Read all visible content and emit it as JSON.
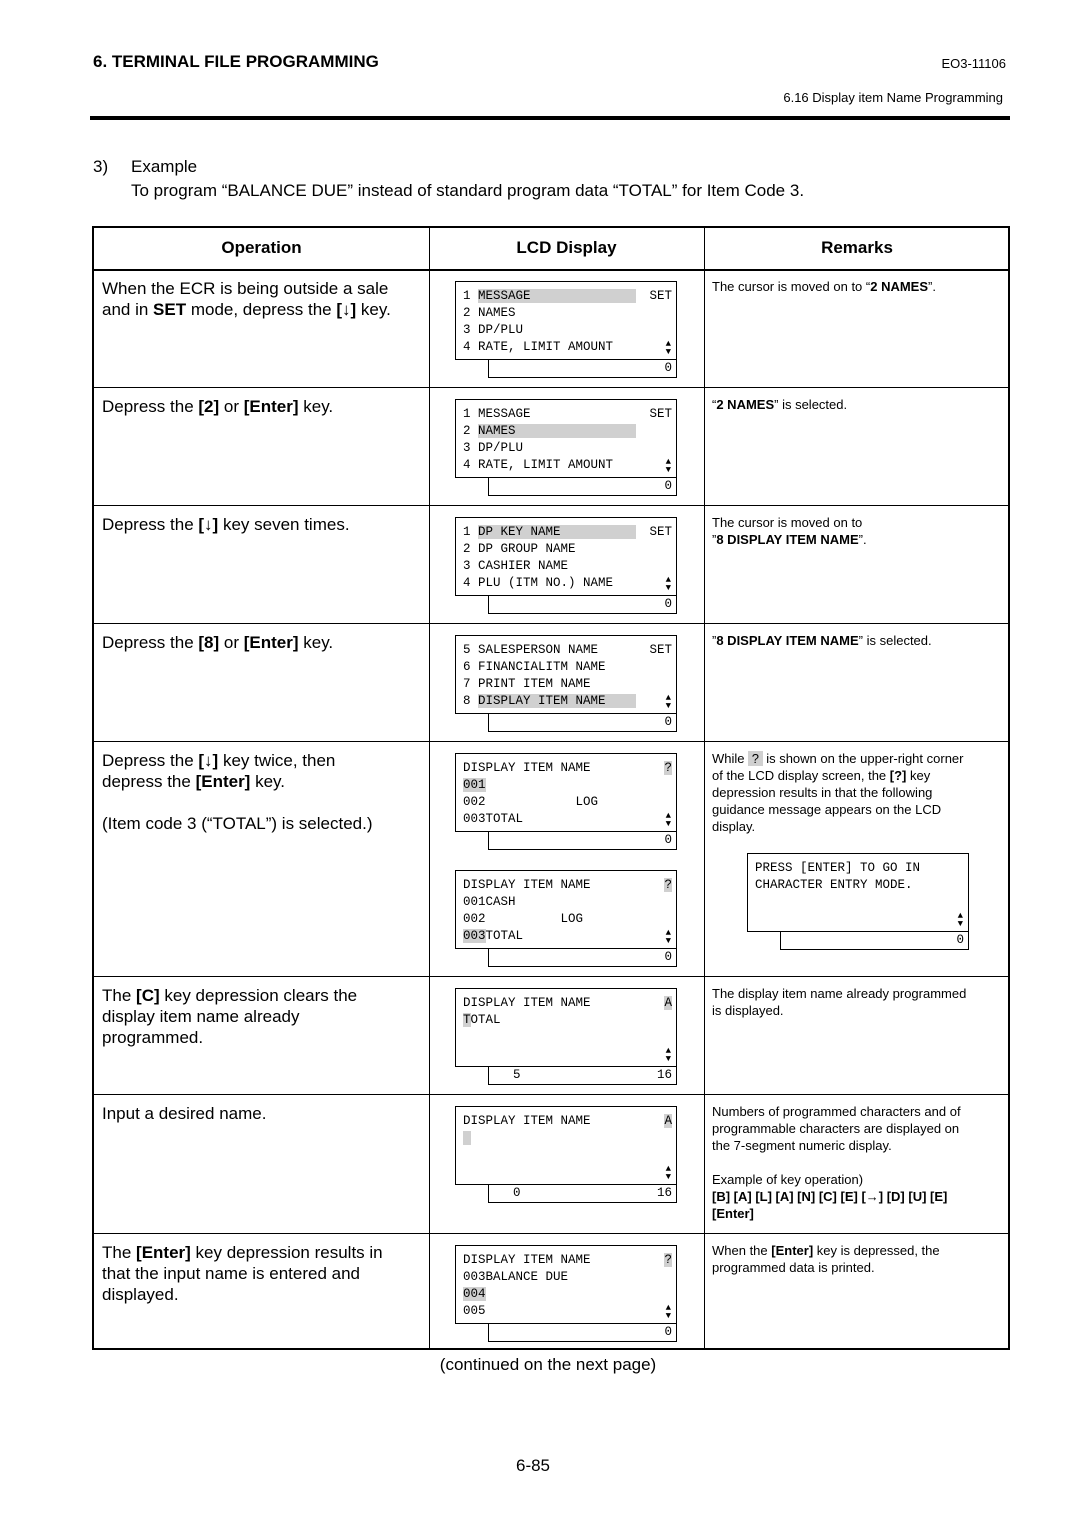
{
  "header": {
    "section": "6. TERMINAL FILE PROGRAMMING",
    "doc_code": "EO3-11106",
    "subsection": "6.16 Display item Name Programming"
  },
  "example": {
    "number": "3)",
    "title": "Example",
    "description": "To program “BALANCE DUE” instead of standard program data “TOTAL” for Item Code 3."
  },
  "table": {
    "headers": [
      "Operation",
      "LCD Display",
      "Remarks"
    ],
    "rows": [
      {
        "operation": [
          [
            {
              "t": "When the ECR is being outside a sale"
            }
          ],
          [
            {
              "t": "and in "
            },
            {
              "t": "SET",
              "b": true
            },
            {
              "t": " mode, depress the "
            },
            {
              "t": "[↓]",
              "b": true
            },
            {
              "t": " key."
            }
          ]
        ],
        "remarks": [
          [
            {
              "t": "The cursor is moved on to “"
            },
            {
              "t": "2 NAMES",
              "b": true
            },
            {
              "t": "”."
            }
          ]
        ],
        "lcds": [
          {
            "lines": [
              [
                {
                  "t": "1 "
                },
                {
                  "t": "MESSAGE              ",
                  "hl": true
                }
              ],
              [
                {
                  "t": "2 NAMES"
                }
              ],
              [
                {
                  "t": "3 DP/PLU"
                }
              ],
              [
                {
                  "t": "4 RATE, LIMIT AMOUNT"
                }
              ]
            ],
            "right": {
              "t": "SET"
            },
            "footer": [
              "",
              "0"
            ]
          }
        ]
      },
      {
        "operation": [
          [
            {
              "t": "Depress the "
            },
            {
              "t": "[2]",
              "b": true
            },
            {
              "t": " or "
            },
            {
              "t": "[Enter]",
              "b": true
            },
            {
              "t": " key."
            }
          ]
        ],
        "remarks": [
          [
            {
              "t": "“"
            },
            {
              "t": "2 NAMES",
              "b": true
            },
            {
              "t": "” is selected."
            }
          ]
        ],
        "lcds": [
          {
            "lines": [
              [
                {
                  "t": "1 MESSAGE"
                }
              ],
              [
                {
                  "t": "2 "
                },
                {
                  "t": "NAMES                ",
                  "hl": true
                }
              ],
              [
                {
                  "t": "3 DP/PLU"
                }
              ],
              [
                {
                  "t": "4 RATE, LIMIT AMOUNT"
                }
              ]
            ],
            "right": {
              "t": "SET"
            },
            "footer": [
              "",
              "0"
            ]
          }
        ]
      },
      {
        "operation": [
          [
            {
              "t": "Depress the "
            },
            {
              "t": "[↓]",
              "b": true
            },
            {
              "t": " key seven times."
            }
          ]
        ],
        "remarks": [
          [
            {
              "t": "The cursor is moved on to"
            }
          ],
          [
            {
              "t": "”"
            },
            {
              "t": "8 DISPLAY ITEM NAME",
              "b": true
            },
            {
              "t": "”."
            }
          ]
        ],
        "lcds": [
          {
            "lines": [
              [
                {
                  "t": "1 "
                },
                {
                  "t": "DP KEY NAME          ",
                  "hl": true
                }
              ],
              [
                {
                  "t": "2 DP GROUP NAME"
                }
              ],
              [
                {
                  "t": "3 CASHIER NAME"
                }
              ],
              [
                {
                  "t": "4 PLU (ITM NO.) NAME"
                }
              ]
            ],
            "right": {
              "t": "SET"
            },
            "footer": [
              "",
              "0"
            ]
          }
        ]
      },
      {
        "operation": [
          [
            {
              "t": "Depress the "
            },
            {
              "t": "[8]",
              "b": true
            },
            {
              "t": " or "
            },
            {
              "t": "[Enter]",
              "b": true
            },
            {
              "t": " key."
            }
          ]
        ],
        "remarks": [
          [
            {
              "t": "”"
            },
            {
              "t": "8 DISPLAY ITEM NAME",
              "b": true
            },
            {
              "t": "” is selected."
            }
          ]
        ],
        "lcds": [
          {
            "lines": [
              [
                {
                  "t": "5 SALESPERSON NAME"
                }
              ],
              [
                {
                  "t": "6 FINANCIALITM NAME"
                }
              ],
              [
                {
                  "t": "7 PRINT ITEM NAME"
                }
              ],
              [
                {
                  "t": "8 "
                },
                {
                  "t": "DISPLAY ITEM NAME    ",
                  "hl": true
                }
              ]
            ],
            "right": {
              "t": "SET"
            },
            "footer": [
              "",
              "0"
            ]
          }
        ]
      },
      {
        "operation": [
          [
            {
              "t": "Depress the "
            },
            {
              "t": "[↓]",
              "b": true
            },
            {
              "t": " key twice, then"
            }
          ],
          [
            {
              "t": "depress the "
            },
            {
              "t": "[Enter]",
              "b": true
            },
            {
              "t": " key."
            }
          ],
          [
            {
              "t": " "
            }
          ],
          [
            {
              "t": "(Item code 3 (“TOTAL”) is selected.)"
            }
          ]
        ],
        "remarks": [
          [
            {
              "t": "While "
            },
            {
              "t": " ? ",
              "hl": true
            },
            {
              "t": " is shown on the upper-right corner"
            }
          ],
          [
            {
              "t": "of the LCD display screen, the "
            },
            {
              "t": "[?]",
              "b": true
            },
            {
              "t": " key"
            }
          ],
          [
            {
              "t": "depression results in that the following"
            }
          ],
          [
            {
              "t": "guidance message appears on the LCD"
            }
          ],
          [
            {
              "t": "display."
            }
          ]
        ],
        "lcds": [
          {
            "lines": [
              [
                {
                  "t": "DISPLAY ITEM NAME"
                }
              ],
              [
                {
                  "t": "001",
                  "hl": true
                }
              ],
              [
                {
                  "t": "002            LOG"
                }
              ],
              [
                {
                  "t": "003TOTAL"
                }
              ]
            ],
            "right": {
              "t": "?",
              "hl": true
            },
            "footer": [
              "",
              "0"
            ]
          },
          {
            "lines": [
              [
                {
                  "t": "DISPLAY ITEM NAME"
                }
              ],
              [
                {
                  "t": "001CASH"
                }
              ],
              [
                {
                  "t": "002          LOG"
                }
              ],
              [
                {
                  "t": "003",
                  "hl": true
                },
                {
                  "t": "TOTAL"
                }
              ]
            ],
            "right": {
              "t": "?",
              "hl": true
            },
            "footer": [
              "",
              "0"
            ]
          }
        ],
        "guidance_lcd": {
          "lines": [
            [
              {
                "t": "PRESS [ENTER] TO GO IN"
              }
            ],
            [
              {
                "t": "CHARACTER ENTRY MODE."
              }
            ],
            [
              {
                "t": ""
              }
            ],
            [
              {
                "t": ""
              }
            ]
          ],
          "footer": [
            "",
            "0"
          ]
        }
      },
      {
        "operation": [
          [
            {
              "t": "The "
            },
            {
              "t": "[C]",
              "b": true
            },
            {
              "t": " key depression clears the"
            }
          ],
          [
            {
              "t": "display item name already"
            }
          ],
          [
            {
              "t": "programmed."
            }
          ]
        ],
        "remarks": [
          [
            {
              "t": "The display item name already programmed"
            }
          ],
          [
            {
              "t": "is displayed."
            }
          ]
        ],
        "lcds": [
          {
            "lines": [
              [
                {
                  "t": "DISPLAY ITEM NAME"
                }
              ],
              [
                {
                  "t": "T",
                  "hl": true
                },
                {
                  "t": "OTAL"
                }
              ],
              [
                {
                  "t": ""
                }
              ],
              [
                {
                  "t": ""
                }
              ]
            ],
            "right": {
              "t": "A",
              "hl": true
            },
            "footer": [
              "5",
              "16"
            ]
          }
        ]
      },
      {
        "operation": [
          [
            {
              "t": "Input a desired name."
            }
          ]
        ],
        "remarks": [
          [
            {
              "t": "Numbers of programmed characters and of"
            }
          ],
          [
            {
              "t": "programmable characters are displayed on"
            }
          ],
          [
            {
              "t": "the 7-segment numeric display."
            }
          ],
          [
            {
              "t": " "
            }
          ],
          [
            {
              "t": "Example of key operation)"
            }
          ],
          [
            {
              "t": "[B] [A] [L] [A] [N] [C] [E] [→] [D] [U] [E]",
              "b": true
            }
          ],
          [
            {
              "t": "[Enter]",
              "b": true
            }
          ]
        ],
        "lcds": [
          {
            "lines": [
              [
                {
                  "t": "DISPLAY ITEM NAME"
                }
              ],
              [
                {
                  "t": " ",
                  "hl": true
                }
              ],
              [
                {
                  "t": ""
                }
              ],
              [
                {
                  "t": ""
                }
              ]
            ],
            "right": {
              "t": "A",
              "hl": true
            },
            "footer": [
              "0",
              "16"
            ]
          }
        ]
      },
      {
        "operation": [
          [
            {
              "t": "The "
            },
            {
              "t": "[Enter]",
              "b": true
            },
            {
              "t": " key depression results in"
            }
          ],
          [
            {
              "t": "that the input name is entered and"
            }
          ],
          [
            {
              "t": "displayed."
            }
          ]
        ],
        "remarks": [
          [
            {
              "t": "When the "
            },
            {
              "t": "[Enter]",
              "b": true
            },
            {
              "t": " key is depressed, the"
            }
          ],
          [
            {
              "t": "programmed data is printed."
            }
          ]
        ],
        "lcds": [
          {
            "lines": [
              [
                {
                  "t": "DISPLAY ITEM NAME"
                }
              ],
              [
                {
                  "t": "003BALANCE DUE"
                }
              ],
              [
                {
                  "t": "004",
                  "hl": true
                }
              ],
              [
                {
                  "t": "005"
                }
              ]
            ],
            "right": {
              "t": "?",
              "hl": true
            },
            "footer": [
              "",
              "0"
            ]
          }
        ]
      }
    ]
  },
  "continued": "(continued on the next page)",
  "page_number": "6-85",
  "icons": {
    "scroll": "up-down-triangle-icon"
  }
}
